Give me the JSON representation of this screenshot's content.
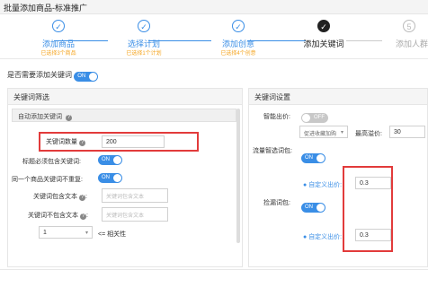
{
  "window": {
    "title": "批量添加商品-标准推广"
  },
  "steps": [
    {
      "label": "添加商品",
      "sub": "已选择3个商品",
      "state": "done",
      "mark": "✓"
    },
    {
      "label": "选择计划",
      "sub": "已选择1个计划",
      "state": "done",
      "mark": "✓"
    },
    {
      "label": "添加创意",
      "sub": "已选择4个创意",
      "state": "done",
      "mark": "✓"
    },
    {
      "label": "添加关键词",
      "sub": "",
      "state": "current",
      "mark": "✓"
    },
    {
      "label": "添加人群",
      "sub": "",
      "state": "todo",
      "mark": "5"
    }
  ],
  "top_question": {
    "label": "是否需要添加关键词",
    "toggle": "ON"
  },
  "left_panel": {
    "title": "关键词筛选",
    "section": "自动添加关键词",
    "count_label": "关键词数量",
    "count_value": "200",
    "must_include_label": "标题必须包含关键词:",
    "must_include_toggle": "ON",
    "no_repeat_label": "同一个商品关键词不重复:",
    "no_repeat_toggle": "ON",
    "include_text_label": "关键词包含文本",
    "include_text_placeholder": "关键词包含文本",
    "exclude_text_label": "关键词不包含文本",
    "exclude_text_placeholder": "关键词包含文本",
    "relevance_value": "1",
    "relevance_label": "<= 相关性"
  },
  "right_panel": {
    "title": "关键词设置",
    "smart_bid_label": "智能出价:",
    "smart_bid_toggle": "OFF",
    "promote_select": "促进收藏加购",
    "max_premium_label": "最高溢价:",
    "max_premium_value": "30",
    "traffic_label": "流量智选词包:",
    "traffic_toggle": "ON",
    "custom_bid_label": "自定义出价:",
    "custom_bid_value_1": "0.3",
    "pick_leak_label": "捡漏词包:",
    "pick_leak_toggle": "ON",
    "custom_bid_value_2": "0.3"
  },
  "colors": {
    "accent": "#3a8ee6",
    "highlight": "#e23b3b",
    "warning": "#f5a623"
  }
}
